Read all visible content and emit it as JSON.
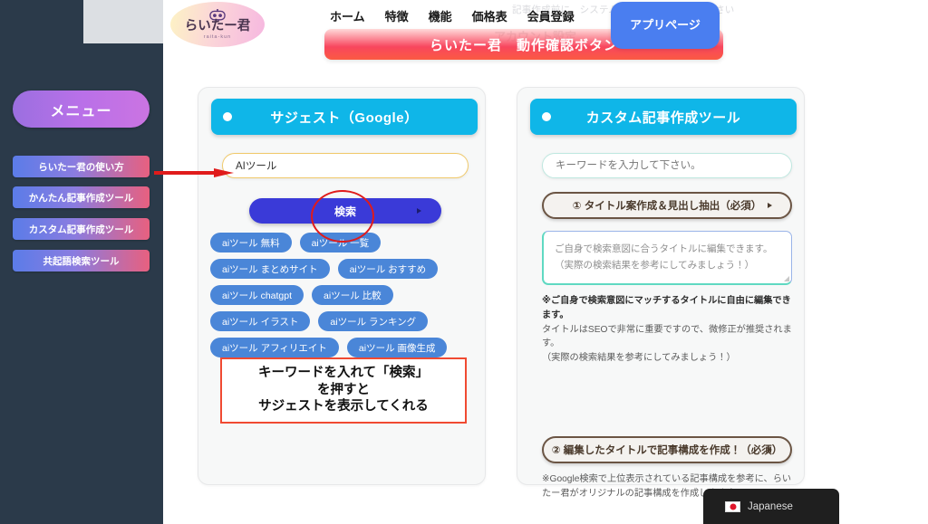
{
  "app": {
    "logo_jp": "らいたー君",
    "logo_romaji": "raita-kun",
    "logo_icon": "robot-icon"
  },
  "header": {
    "faint_notice": "記事作成前に、システム稼働中か必ずご確認下さい",
    "nav_primary": [
      {
        "label": "ホーム"
      },
      {
        "label": "特徴"
      },
      {
        "label": "機能"
      },
      {
        "label": "価格表"
      },
      {
        "label": "会員登録"
      }
    ],
    "nav_secondary": {
      "label": "アカウント設定"
    },
    "app_button": "アプリページ",
    "ghost_pill": "必ず確認！",
    "banner": "らいたー君　動作確認ボタン"
  },
  "sidebar": {
    "menu_label": "メニュー",
    "items": [
      {
        "label": "らいたー君の使い方"
      },
      {
        "label": "かんたん記事作成ツール"
      },
      {
        "label": "カスタム記事作成ツール"
      },
      {
        "label": "共起語検索ツール"
      }
    ]
  },
  "suggest_card": {
    "title": "サジェスト（Google）",
    "input_value": "AIツール",
    "input_placeholder": "キーワードを入力して下さい。",
    "search_button": "検索",
    "tags": [
      "aiツール 無料",
      "aiツール 一覧",
      "aiツール まとめサイト",
      "aiツール おすすめ",
      "aiツール chatgpt",
      "aiツール 比較",
      "aiツール イラスト",
      "aiツール ランキング",
      "aiツール アフィリエイト",
      "aiツール 画像生成"
    ],
    "annotation": {
      "line1": "キーワードを入れて「検索」",
      "line2": "を押すと",
      "line3": "サジェストを表示してくれる"
    }
  },
  "custom_card": {
    "title": "カスタム記事作成ツール",
    "input_placeholder": "キーワードを入力して下さい。",
    "step1_button": "① タイトル案作成＆見出し抽出（必須）",
    "textarea_line1": "ご自身で検索意図に合うタイトルに編集できます。",
    "textarea_line2": "（実際の検索結果を参考にしてみましょう！）",
    "note1_bold": "※ご自身で検索意図にマッチするタイトルに自由に編集できます。",
    "note1_rest": "タイトルはSEOで非常に重要ですので、微修正が推奨されます。",
    "note1_paren": "（実際の検索結果を参考にしてみましょう！）",
    "step2_button": "② 編集したタイトルで記事構成を作成！（必須）",
    "note2": "※Google検索で上位表示されている記事構成を参考に、らいたー君がオリジナルの記事構成を作成します。）"
  },
  "language_widget": {
    "label": "Japanese",
    "flag_icon": "japan-flag-icon"
  },
  "colors": {
    "sidebar_bg": "#2b3a4a",
    "card_header": "#0fb6e8",
    "search_button": "#3a3ad8",
    "tag": "#4a86d8",
    "annotation_red": "#e01b1b",
    "banner_red": "#f8465e",
    "app_button_blue": "#4a7ef0"
  }
}
